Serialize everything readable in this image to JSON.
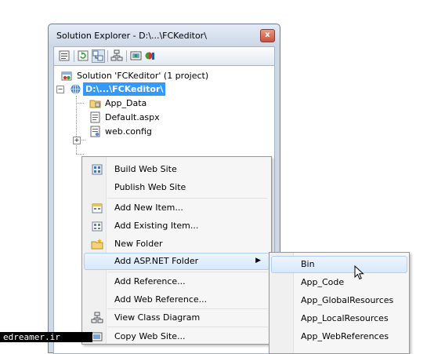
{
  "window": {
    "title": "Solution Explorer - D:\\...\\FCKeditor\\",
    "close_glyph": "x"
  },
  "toolbar": {
    "buttons": [
      "properties-icon",
      "refresh-icon",
      "nest-related-files-icon",
      "view-class-diagram-icon",
      "copy-web-site-icon",
      "asp-net-configuration-icon"
    ]
  },
  "tree": {
    "solution": "Solution 'FCKeditor' (1 project)",
    "project": "D:\\...\\FCKeditor\\",
    "items": [
      "App_Data",
      "Default.aspx",
      "web.config"
    ]
  },
  "context_menu": {
    "items": [
      {
        "label": "Build Web Site",
        "icon": "build-icon"
      },
      {
        "label": "Publish Web Site",
        "icon": ""
      },
      {
        "label": "Add New Item...",
        "icon": "add-new-item-icon"
      },
      {
        "label": "Add Existing Item...",
        "icon": "add-existing-item-icon"
      },
      {
        "label": "New Folder",
        "icon": "new-folder-icon"
      },
      {
        "label": "Add ASP.NET Folder",
        "icon": "",
        "submenu_arrow": "▶"
      },
      {
        "label": "Add Reference...",
        "icon": ""
      },
      {
        "label": "Add Web Reference...",
        "icon": ""
      },
      {
        "label": "View Class Diagram",
        "icon": "class-diagram-icon"
      },
      {
        "label": "Copy Web Site...",
        "icon": "copy-web-site-icon"
      }
    ]
  },
  "submenu": {
    "items": [
      "Bin",
      "App_Code",
      "App_GlobalResources",
      "App_LocalResources",
      "App_WebReferences"
    ]
  },
  "watermark": "edreamer.ir",
  "colors": {
    "selection": "#3399ff",
    "hover_border": "#aecff7",
    "window_frame": "#cfd9e6"
  }
}
